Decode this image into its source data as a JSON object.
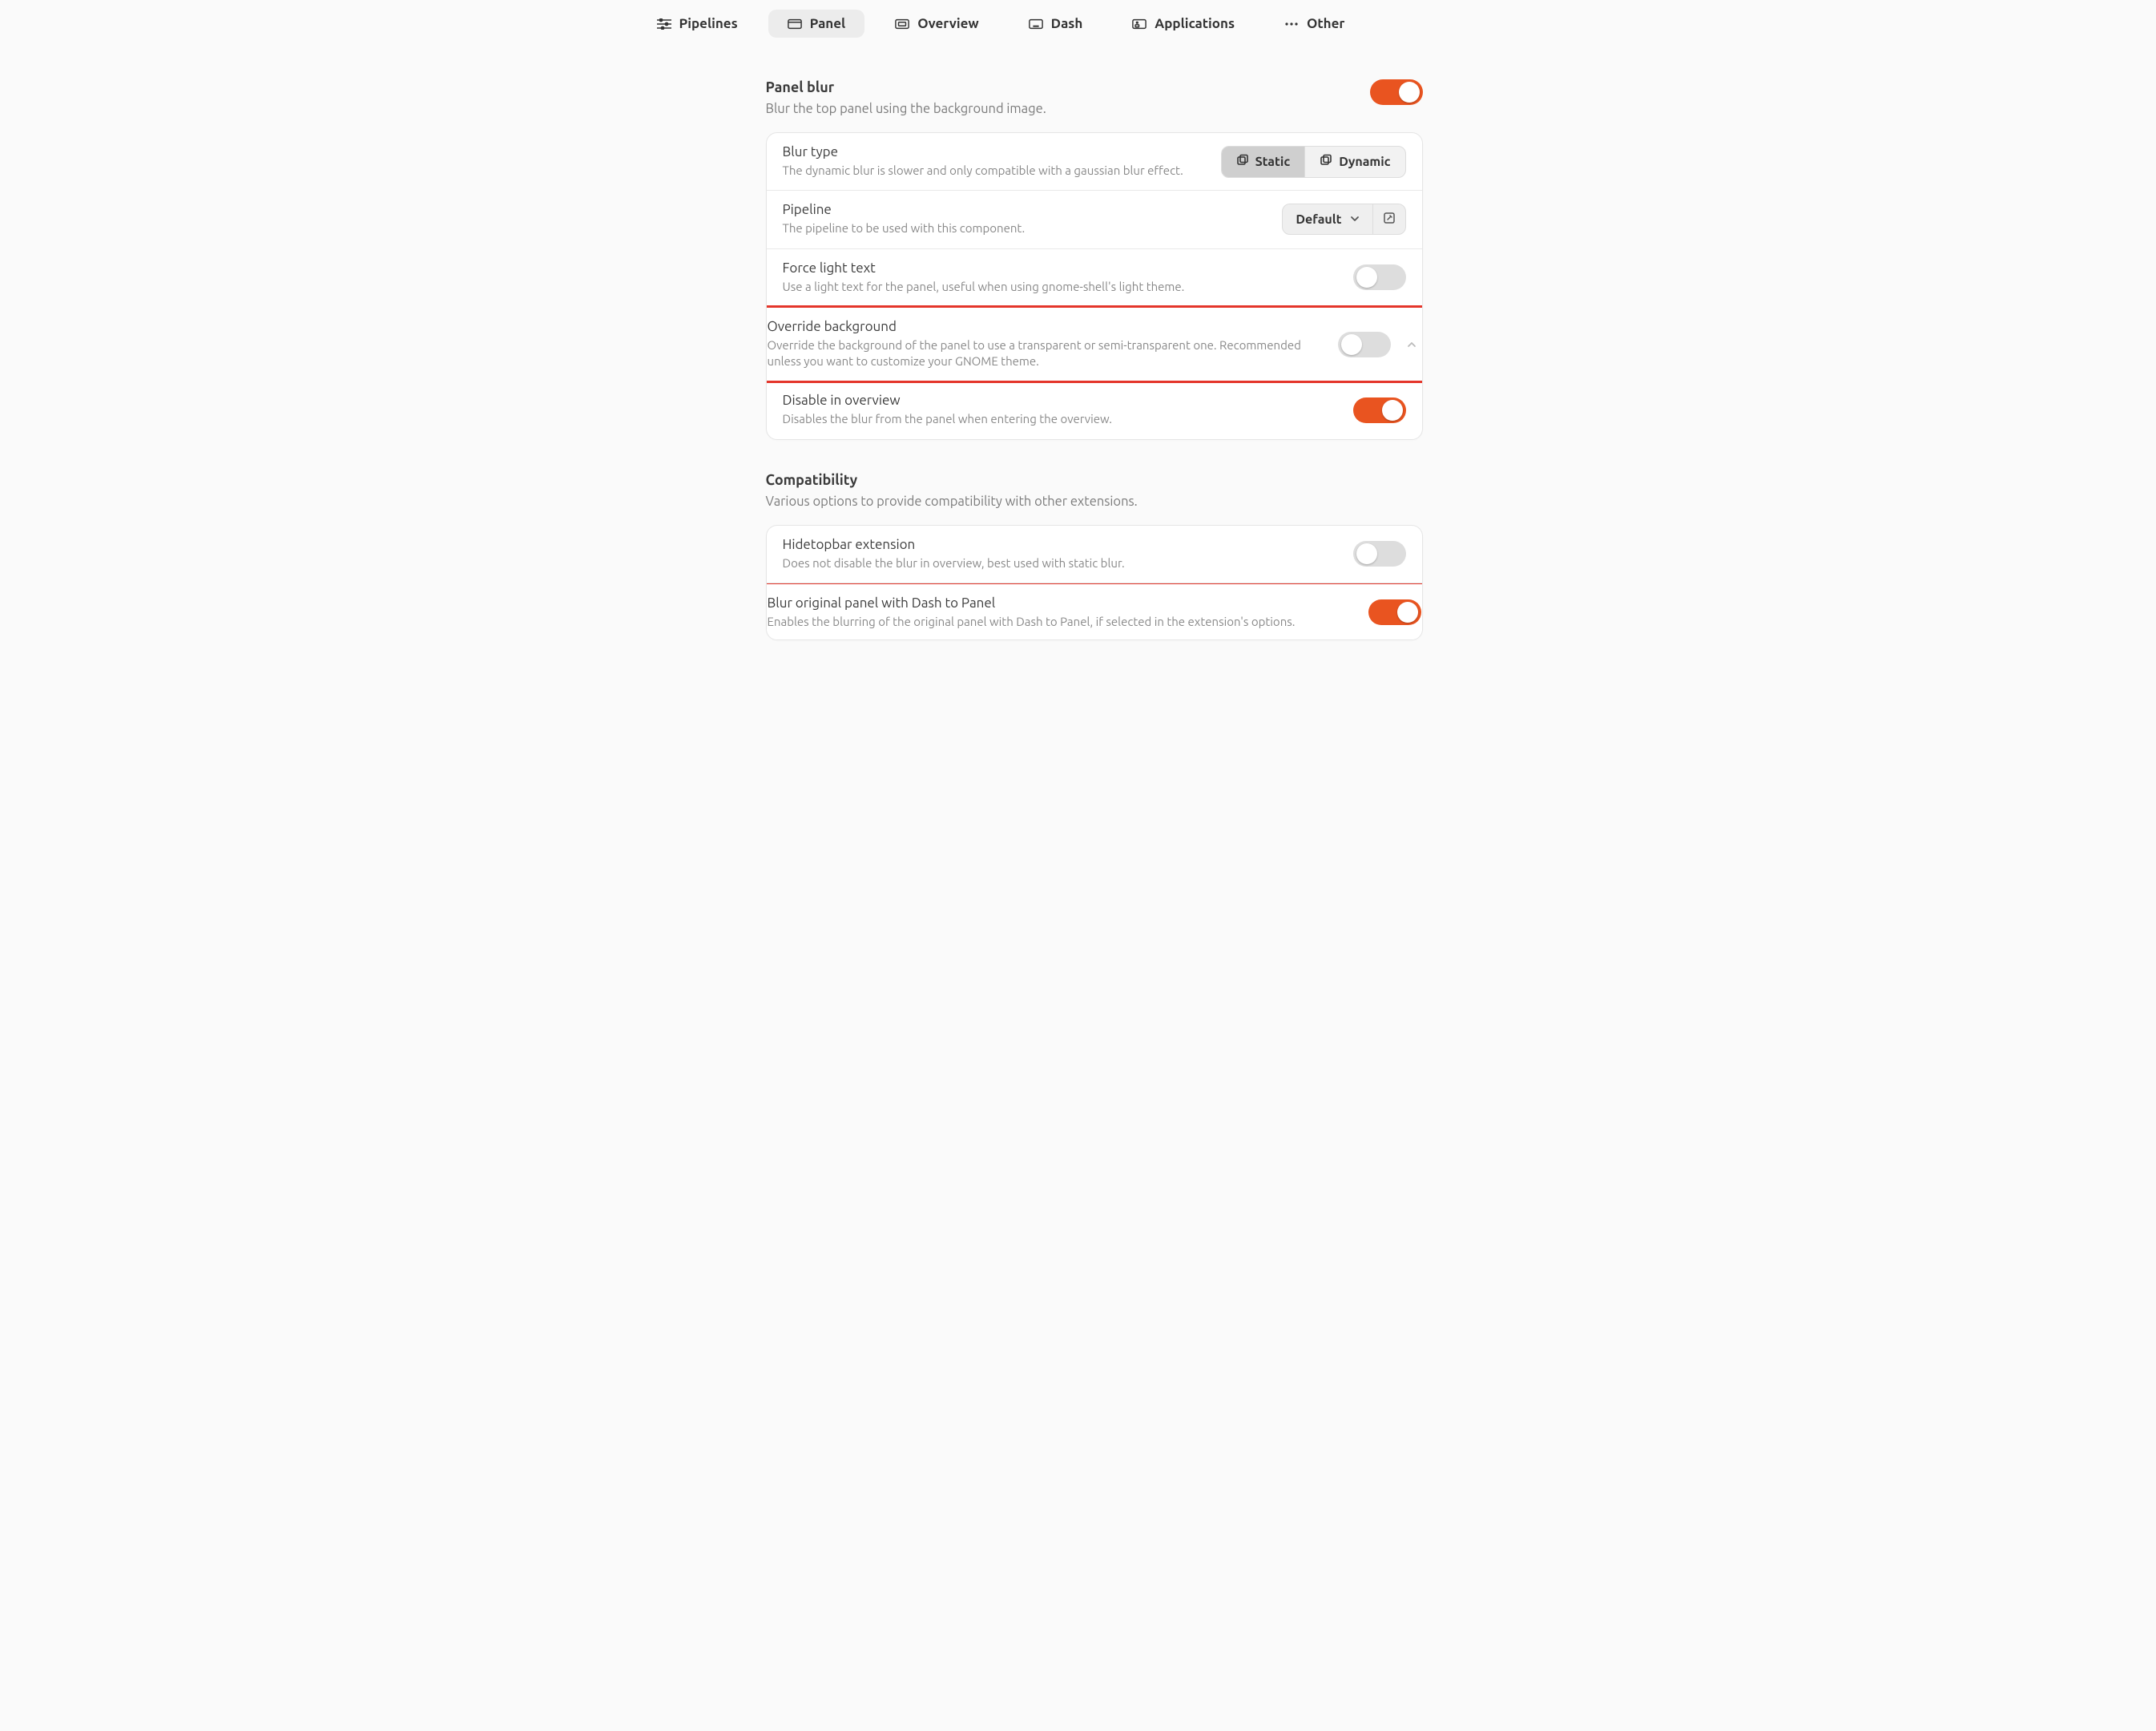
{
  "tabs": {
    "pipelines": {
      "label": "Pipelines"
    },
    "panel": {
      "label": "Panel"
    },
    "overview": {
      "label": "Overview"
    },
    "dash": {
      "label": "Dash"
    },
    "applications": {
      "label": "Applications"
    },
    "other": {
      "label": "Other"
    }
  },
  "active_tab": "panel",
  "panel_blur": {
    "title": "Panel blur",
    "desc": "Blur the top panel using the background image.",
    "master_toggle": true,
    "blur_type": {
      "label": "Blur type",
      "desc": "The dynamic blur is slower and only compatible with a gaussian blur effect.",
      "options": {
        "static": "Static",
        "dynamic": "Dynamic"
      },
      "selected": "static"
    },
    "pipeline": {
      "label": "Pipeline",
      "desc": "The pipeline to be used with this component.",
      "value": "Default"
    },
    "force_light_text": {
      "label": "Force light text",
      "desc": "Use a light text for the panel, useful when using gnome-shell's light theme.",
      "value": false
    },
    "override_background": {
      "label": "Override background",
      "desc": "Override the background of the panel to use a transparent or semi-transparent one. Recommended unless you want to customize your GNOME theme.",
      "value": false
    },
    "disable_in_overview": {
      "label": "Disable in overview",
      "desc": "Disables the blur from the panel when entering the overview.",
      "value": true
    }
  },
  "compatibility": {
    "title": "Compatibility",
    "desc": "Various options to provide compatibility with other extensions.",
    "hidetopbar": {
      "label": "Hidetopbar extension",
      "desc": "Does not disable the blur in overview, best used with static blur.",
      "value": false
    },
    "dash_to_panel": {
      "label": "Blur original panel with Dash to Panel",
      "desc": "Enables the blurring of the original panel with Dash to Panel, if selected in the extension's options.",
      "value": true
    }
  },
  "colors": {
    "accent": "#e95420",
    "highlight": "#e4362b"
  }
}
